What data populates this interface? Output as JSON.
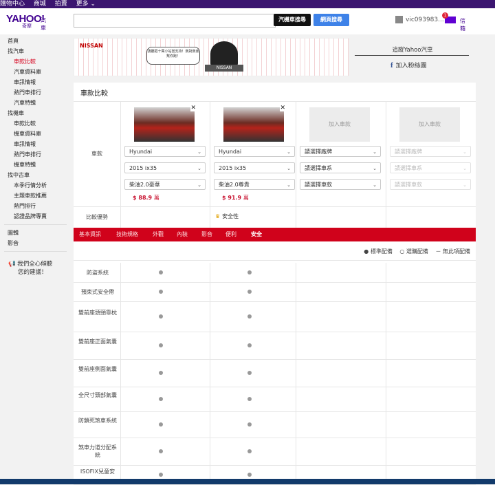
{
  "topbar": {
    "items": [
      "購物中心",
      "商城",
      "拍賣",
      "更多 ⌄"
    ]
  },
  "header": {
    "logo": "YAHOO!",
    "logo_sub": "奇摩",
    "logo_section": "汽車",
    "search_placeholder": "",
    "search_car_button": "汽機車搜尋",
    "search_web_button": "網頁搜尋",
    "username": "vic093983...",
    "mail_badge": "1",
    "mail_label": "信箱"
  },
  "sidebar": {
    "items": [
      {
        "label": "首頁",
        "level": 0
      },
      {
        "label": "找汽車",
        "level": 0
      },
      {
        "label": "車款比較",
        "level": 1,
        "active": true
      },
      {
        "label": "汽車資料庫",
        "level": 1
      },
      {
        "label": "車訊情報",
        "level": 1
      },
      {
        "label": "熱門車排行",
        "level": 1
      },
      {
        "label": "汽車特輯",
        "level": 1
      },
      {
        "label": "找機車",
        "level": 0
      },
      {
        "label": "車款比較",
        "level": 1
      },
      {
        "label": "機車資料庫",
        "level": 1
      },
      {
        "label": "車訊情報",
        "level": 1
      },
      {
        "label": "熱門車排行",
        "level": 1
      },
      {
        "label": "機車特輯",
        "level": 1
      },
      {
        "label": "找中古車",
        "level": 0
      },
      {
        "label": "本季行情分析",
        "level": 1
      },
      {
        "label": "主題車款推薦",
        "level": 1
      },
      {
        "label": "熱門排行",
        "level": 1
      },
      {
        "label": "認證品牌專賣",
        "level": 1
      }
    ],
    "extra": [
      "圖輯",
      "影音"
    ],
    "feedback_line1": "我們全心傾聽",
    "feedback_line2": "您的建議！"
  },
  "banner": {
    "brand": "NISSAN",
    "bubble_text": "請聽把十萬小站當支持！我對我會幫你跑！",
    "logo_text": "NISSAN"
  },
  "social": {
    "follow": "追蹤Yahoo汽車",
    "fb_join": "加入粉絲團"
  },
  "compare": {
    "title": "車款比較",
    "car_label": "車款",
    "advantage_label": "比較優勢",
    "add_car": "加入車款",
    "slots": [
      {
        "brand": "Hyundai",
        "model": "2015 ix35",
        "trim": "柴油2.0豪華",
        "price_prefix": "$",
        "price": "88.9",
        "price_unit": "萬",
        "filled": true,
        "advantage": ""
      },
      {
        "brand": "Hyundai",
        "model": "2015 ix35",
        "trim": "柴油2.0尊貴",
        "price_prefix": "$",
        "price": "91.9",
        "price_unit": "萬",
        "filled": true,
        "advantage": "安全性"
      },
      {
        "brand": "請選擇廠牌",
        "model": "請選擇車系",
        "trim": "請選擇車款",
        "filled": false,
        "enabled": true
      },
      {
        "brand": "請選擇廠牌",
        "model": "請選擇車系",
        "trim": "請選擇車款",
        "filled": false,
        "enabled": false
      }
    ],
    "tabs": [
      "基本資訊",
      "技術規格",
      "外觀",
      "內裝",
      "影音",
      "便利",
      "安全"
    ],
    "active_tab": "安全",
    "legend": {
      "standard": "● 標準配備",
      "optional": "○ 選購配備",
      "none": "－ 無此項配備"
    },
    "rows": [
      "防盜系統",
      "預束式安全帶",
      "雙前座頭頸靠枕",
      "雙前座正面氣囊",
      "雙前座側面氣囊",
      "全尺寸頭部氣囊",
      "防鎖死煞車系統",
      "煞車力道分配系統",
      "ISOFIX兒童安"
    ]
  }
}
